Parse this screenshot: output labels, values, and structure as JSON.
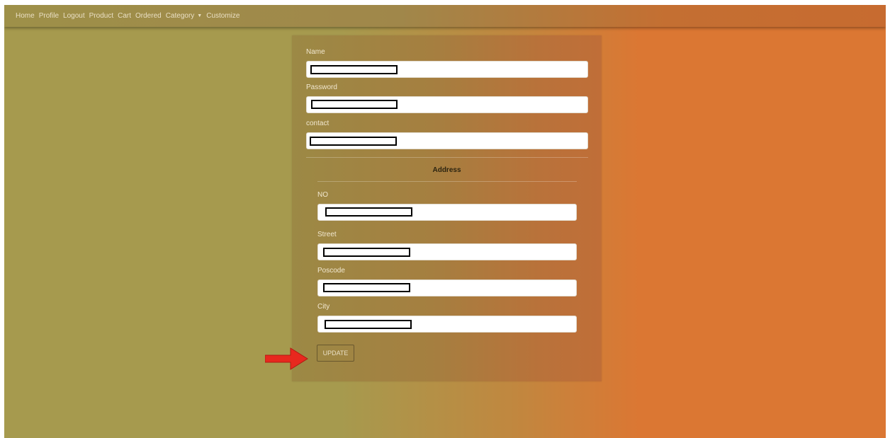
{
  "nav": {
    "items": [
      {
        "label": "Home"
      },
      {
        "label": "Profile"
      },
      {
        "label": "Logout"
      },
      {
        "label": "Product"
      },
      {
        "label": "Cart"
      },
      {
        "label": "Ordered"
      },
      {
        "label": "Category"
      },
      {
        "label": "Customize"
      }
    ]
  },
  "form": {
    "name_label": "Name",
    "password_label": "Password",
    "contact_label": "contact",
    "address_heading": "Address",
    "address": {
      "no_label": "NO",
      "street_label": "Street",
      "poscode_label": "Poscode",
      "city_label": "City"
    },
    "update_label": "UPDATE"
  },
  "annotation": {
    "arrow_color": "#e8281e"
  }
}
